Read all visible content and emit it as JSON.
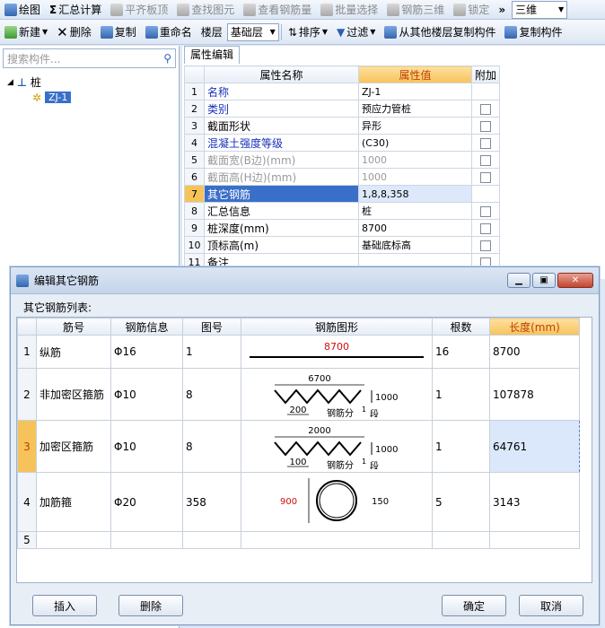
{
  "toolbar1": {
    "items": [
      "绘图",
      "汇总计算",
      "平齐板顶",
      "查找图元",
      "查看钢筋量",
      "批量选择",
      "钢筋三维",
      "锁定"
    ],
    "view_select": "三维"
  },
  "toolbar2": {
    "new": "新建",
    "delete": "删除",
    "copy": "复制",
    "rename": "重命名",
    "floor_label": "楼层",
    "floor_value": "基础层",
    "sort": "排序",
    "filter": "过滤",
    "copy_from_floor": "从其他楼层复制构件",
    "copy_component": "复制构件"
  },
  "left": {
    "search_placeholder": "搜索构件...",
    "tree_root": "桩",
    "tree_child": "ZJ-1"
  },
  "right": {
    "tab": "属性编辑",
    "headers": [
      "属性名称",
      "属性值",
      "附加"
    ],
    "rows": [
      {
        "no": "1",
        "name": "名称",
        "value": "ZJ-1"
      },
      {
        "no": "2",
        "name": "类别",
        "value": "预应力管桩"
      },
      {
        "no": "3",
        "name": "截面形状",
        "value": "异形"
      },
      {
        "no": "4",
        "name": "混凝土强度等级",
        "value": "(C30)"
      },
      {
        "no": "5",
        "name": "截面宽(B边)(mm)",
        "value": "1000"
      },
      {
        "no": "6",
        "name": "截面高(H边)(mm)",
        "value": "1000"
      },
      {
        "no": "7",
        "name": "其它钢筋",
        "value": "1,8,8,358"
      },
      {
        "no": "8",
        "name": "汇总信息",
        "value": "桩"
      },
      {
        "no": "9",
        "name": "桩深度(mm)",
        "value": "8700"
      },
      {
        "no": "10",
        "name": "顶标高(m)",
        "value": "基础底标高"
      },
      {
        "no": "11",
        "name": "备注",
        "value": ""
      }
    ]
  },
  "dialog": {
    "title": "编辑其它钢筋",
    "list_label": "其它钢筋列表:",
    "headers": [
      "筋号",
      "钢筋信息",
      "图号",
      "钢筋图形",
      "根数",
      "长度(mm)"
    ],
    "rows": [
      {
        "no": "1",
        "name": "纵筋",
        "info": "Φ16",
        "fig": "1",
        "count": "16",
        "length": "8700"
      },
      {
        "no": "2",
        "name": "非加密区箍筋",
        "info": "Φ10",
        "fig": "8",
        "count": "1",
        "length": "107878"
      },
      {
        "no": "3",
        "name": "加密区箍筋",
        "info": "Φ10",
        "fig": "8",
        "count": "1",
        "length": "64761"
      },
      {
        "no": "4",
        "name": "加筋箍",
        "info": "Φ20",
        "fig": "358",
        "count": "5",
        "length": "3143"
      },
      {
        "no": "5",
        "name": "",
        "info": "",
        "fig": "",
        "count": "",
        "length": ""
      }
    ],
    "shape1": {
      "len": "8700"
    },
    "shape2": {
      "top": "6700",
      "pitch": "200",
      "height": "1000",
      "note": "钢筋分",
      "sup": "1",
      "seg": "段"
    },
    "shape3": {
      "top": "2000",
      "pitch": "100",
      "height": "1000",
      "note": "钢筋分",
      "sup": "1",
      "seg": "段"
    },
    "shape4": {
      "left": "900",
      "right": "150"
    },
    "buttons": {
      "insert": "插入",
      "delete": "删除",
      "ok": "确定",
      "cancel": "取消"
    }
  }
}
